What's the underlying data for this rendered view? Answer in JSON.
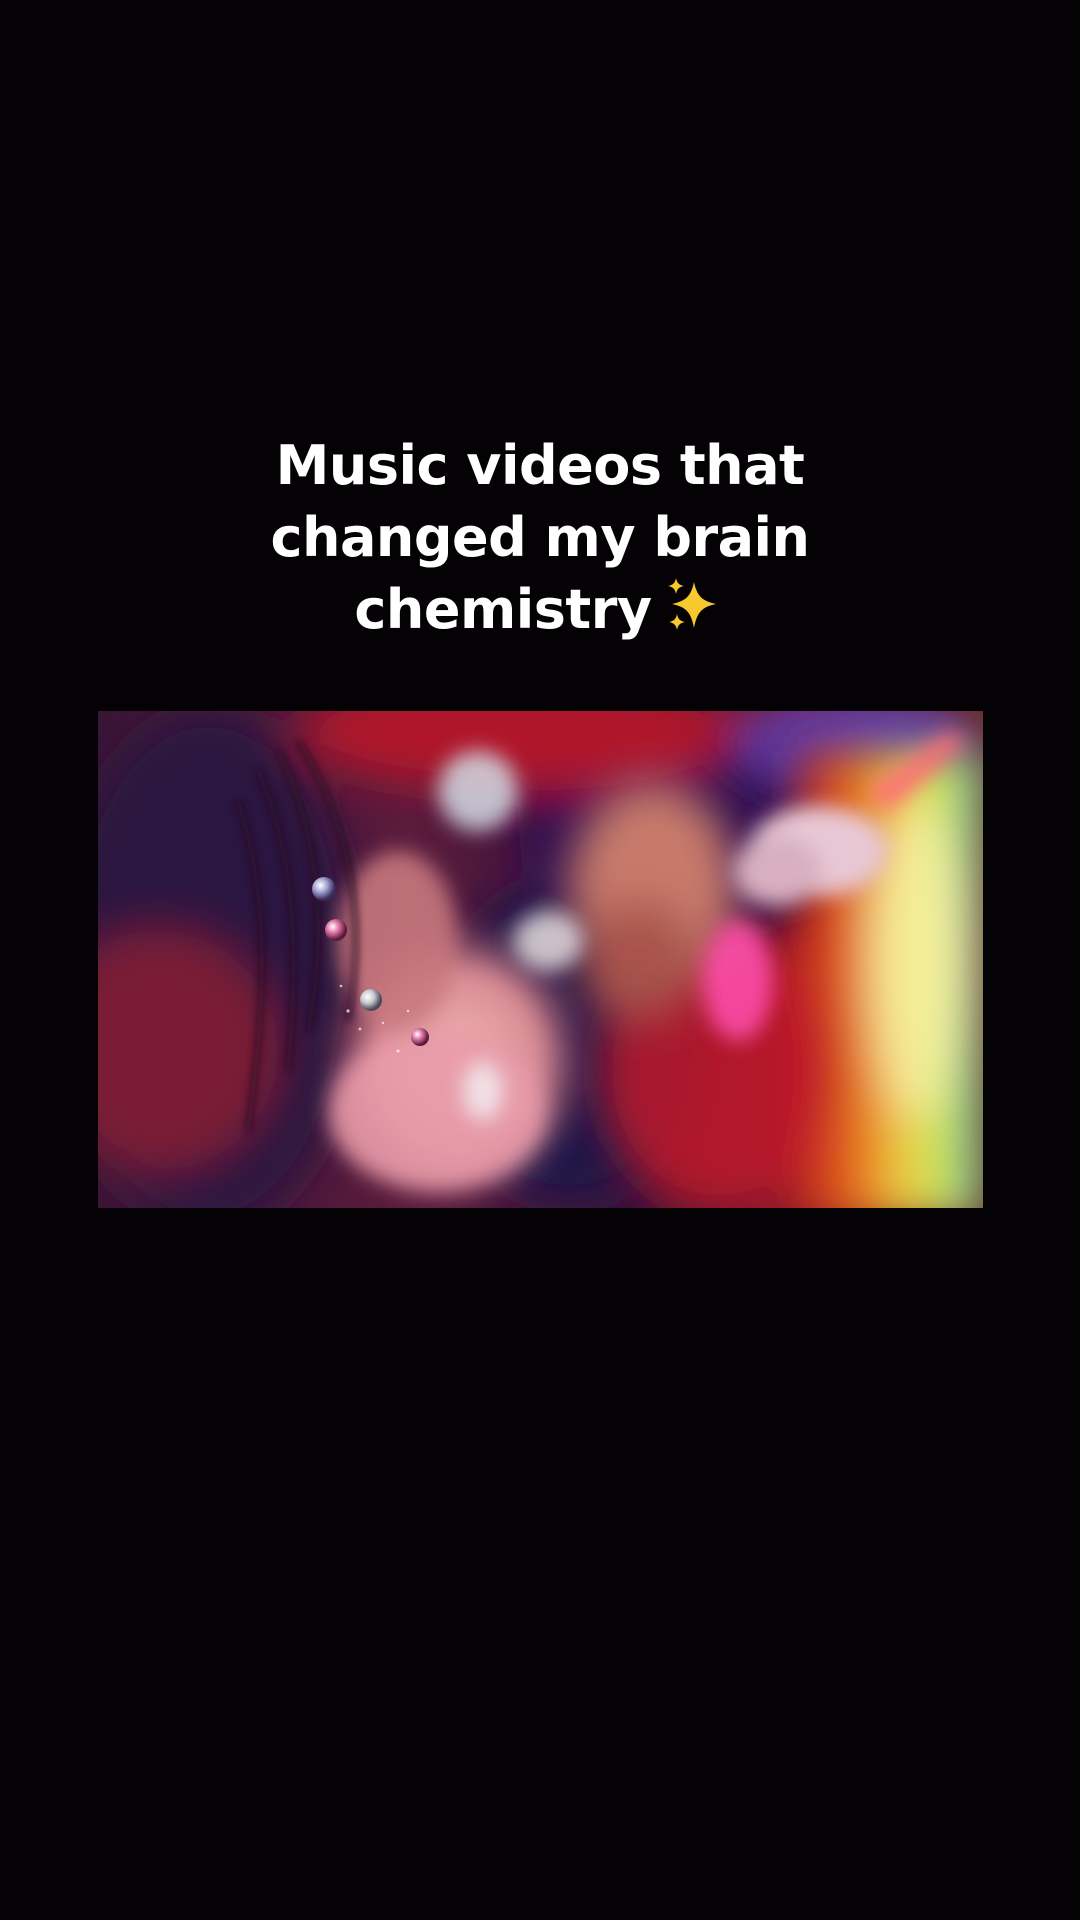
{
  "caption": {
    "lines": [
      "Music videos that",
      "changed my brain",
      "chemistry"
    ]
  },
  "icons": {
    "caption_emoji": "sparkles-icon"
  },
  "video": {
    "description_colors": {
      "accent_yellow": "#f2e64a",
      "accent_pink": "#ff4fb0",
      "accent_red": "#d8202c",
      "shadow_purple": "#3a1a4e"
    }
  }
}
